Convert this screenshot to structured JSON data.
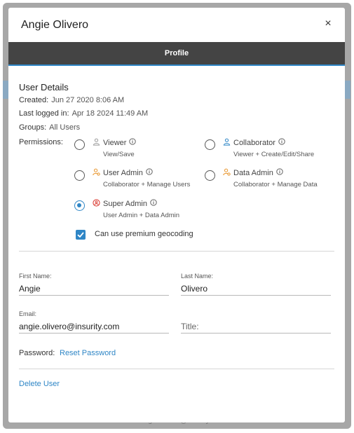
{
  "background": {
    "text": "angie.olivero@insurity.com"
  },
  "modal": {
    "title": "Angie Olivero",
    "close_label": "×",
    "tabs": [
      {
        "label": "Profile",
        "active": true
      }
    ]
  },
  "user_details": {
    "title": "User Details",
    "created_label": "Created:",
    "created_value": "Jun 27 2020 8:06 AM",
    "last_login_label": "Last logged in:",
    "last_login_value": "Apr 18 2024 11:49 AM",
    "groups_label": "Groups:",
    "groups_value": "All Users"
  },
  "permissions": {
    "label": "Permissions:",
    "roles": [
      {
        "name": "Viewer",
        "description": "View/Save",
        "selected": false,
        "icon": "user-icon",
        "icon_color": "#9a9a9a"
      },
      {
        "name": "Collaborator",
        "description": "Viewer + Create/Edit/Share",
        "selected": false,
        "icon": "user-icon",
        "icon_color": "#2f86c6"
      },
      {
        "name": "User Admin",
        "description": "Collaborator + Manage Users",
        "selected": false,
        "icon": "user-gear-icon",
        "icon_color": "#e8962e"
      },
      {
        "name": "Data Admin",
        "description": "Collaborator + Manage Data",
        "selected": false,
        "icon": "user-gear-icon",
        "icon_color": "#e8962e"
      },
      {
        "name": "Super Admin",
        "description": "User Admin + Data Admin",
        "selected": true,
        "icon": "super-admin-icon",
        "icon_color": "#d9342b"
      }
    ],
    "info_icon": "info-icon",
    "premium_geocoding": {
      "label": "Can use premium geocoding",
      "checked": true
    }
  },
  "form": {
    "first_name": {
      "label": "First Name:",
      "value": "Angie"
    },
    "last_name": {
      "label": "Last Name:",
      "value": "Olivero"
    },
    "email": {
      "label": "Email:",
      "value": "angie.olivero@insurity.com"
    },
    "title": {
      "placeholder": "Title:",
      "value": ""
    },
    "password_label": "Password:",
    "reset_password_label": "Reset Password"
  },
  "delete_user_label": "Delete User",
  "colors": {
    "accent": "#2f86c6",
    "tab_bar": "#444444",
    "warning": "#e8962e",
    "danger": "#d9342b"
  }
}
